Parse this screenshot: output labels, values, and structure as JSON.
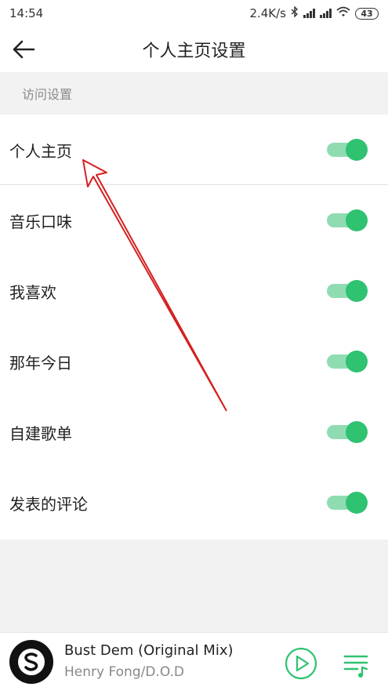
{
  "status_bar": {
    "time": "14:54",
    "network_speed": "2.4K/s",
    "battery": "43",
    "icons": [
      "bluetooth-icon",
      "signal-icon",
      "signal-icon",
      "wifi-icon",
      "battery-icon"
    ]
  },
  "header": {
    "title": "个人主页设置",
    "back_icon": "back-arrow-icon"
  },
  "section": {
    "label": "访问设置"
  },
  "settings": [
    {
      "label": "个人主页",
      "enabled": true
    },
    {
      "label": "音乐口味",
      "enabled": true
    },
    {
      "label": "我喜欢",
      "enabled": true
    },
    {
      "label": "那年今日",
      "enabled": true
    },
    {
      "label": "自建歌单",
      "enabled": true
    },
    {
      "label": "发表的评论",
      "enabled": true
    }
  ],
  "player": {
    "title": "Bust Dem (Original Mix)",
    "artist": "Henry Fong/D.O.D",
    "cover_icon": "album-cover",
    "play_icon": "play-icon",
    "playlist_icon": "playlist-icon"
  },
  "colors": {
    "accent": "#2ec271",
    "toggle_track": "#8fdcb2",
    "annotation": "#d42020"
  }
}
